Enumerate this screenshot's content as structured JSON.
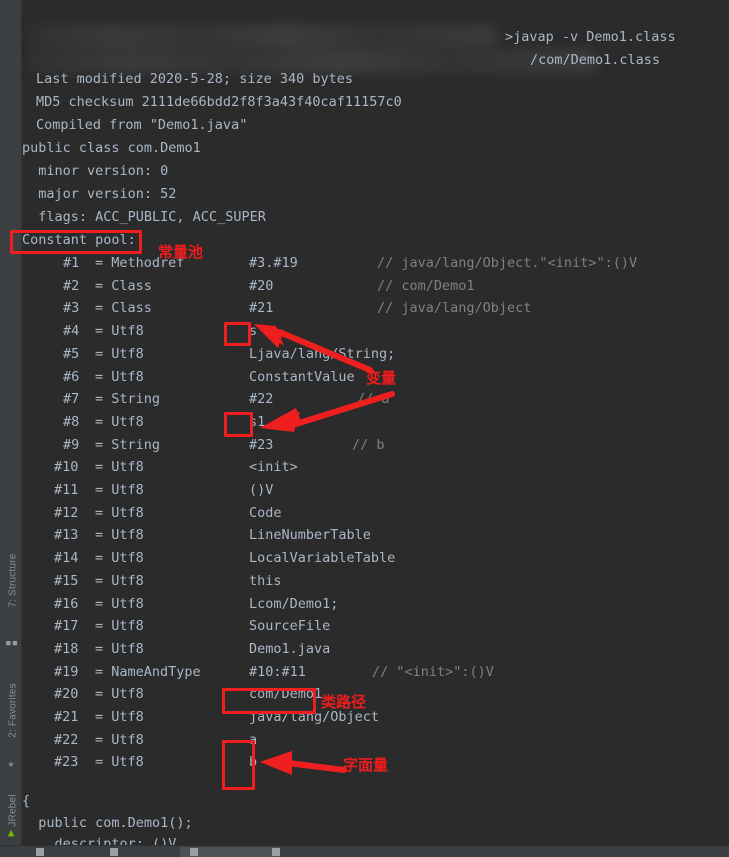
{
  "window": {
    "background": "#2b2b2b",
    "text_color": "#a9b7c6",
    "comment_color": "#808080",
    "annotation_color": "#ee1c1c"
  },
  "sidebar": {
    "items": [
      {
        "label": "7: Structure",
        "icon": "structure-icon"
      },
      {
        "label": "2: Favorites",
        "icon": "star-icon"
      },
      {
        "label": "JRebel",
        "icon": "jrebel-icon"
      }
    ]
  },
  "terminal": {
    "prompt_line": ">javap -v Demo1.class",
    "classfile_line": "/com/Demo1.class",
    "header": [
      "Last modified 2020-5-28; size 340 bytes",
      "MD5 checksum 2111de66bdd2f8f3a43f40caf11157c0",
      "Compiled from \"Demo1.java\"",
      "public class com.Demo1",
      "  minor version: 0",
      "  major version: 52",
      "  flags: ACC_PUBLIC, ACC_SUPER",
      "Constant pool:"
    ],
    "constant_pool": [
      {
        "index": "#1",
        "tag": "= Methodref",
        "value": "#3.#19",
        "comment": "// java/lang/Object.\"<init>\":()V"
      },
      {
        "index": "#2",
        "tag": "= Class",
        "value": "#20",
        "comment": "// com/Demo1"
      },
      {
        "index": "#3",
        "tag": "= Class",
        "value": "#21",
        "comment": "// java/lang/Object"
      },
      {
        "index": "#4",
        "tag": "= Utf8",
        "value": "s",
        "comment": ""
      },
      {
        "index": "#5",
        "tag": "= Utf8",
        "value": "Ljava/lang/String;",
        "comment": ""
      },
      {
        "index": "#6",
        "tag": "= Utf8",
        "value": "ConstantValue",
        "comment": ""
      },
      {
        "index": "#7",
        "tag": "= String",
        "value": "#22",
        "comment": "// a"
      },
      {
        "index": "#8",
        "tag": "= Utf8",
        "value": "s1",
        "comment": ""
      },
      {
        "index": "#9",
        "tag": "= String",
        "value": "#23",
        "comment": "// b"
      },
      {
        "index": "#10",
        "tag": "= Utf8",
        "value": "<init>",
        "comment": ""
      },
      {
        "index": "#11",
        "tag": "= Utf8",
        "value": "()V",
        "comment": ""
      },
      {
        "index": "#12",
        "tag": "= Utf8",
        "value": "Code",
        "comment": ""
      },
      {
        "index": "#13",
        "tag": "= Utf8",
        "value": "LineNumberTable",
        "comment": ""
      },
      {
        "index": "#14",
        "tag": "= Utf8",
        "value": "LocalVariableTable",
        "comment": ""
      },
      {
        "index": "#15",
        "tag": "= Utf8",
        "value": "this",
        "comment": ""
      },
      {
        "index": "#16",
        "tag": "= Utf8",
        "value": "Lcom/Demo1;",
        "comment": ""
      },
      {
        "index": "#17",
        "tag": "= Utf8",
        "value": "SourceFile",
        "comment": ""
      },
      {
        "index": "#18",
        "tag": "= Utf8",
        "value": "Demo1.java",
        "comment": ""
      },
      {
        "index": "#19",
        "tag": "= NameAndType",
        "value": "#10:#11",
        "comment": "// \"<init>\":()V"
      },
      {
        "index": "#20",
        "tag": "= Utf8",
        "value": "com/Demo1",
        "comment": ""
      },
      {
        "index": "#21",
        "tag": "= Utf8",
        "value": "java/lang/Object",
        "comment": ""
      },
      {
        "index": "#22",
        "tag": "= Utf8",
        "value": "a",
        "comment": ""
      },
      {
        "index": "#23",
        "tag": "= Utf8",
        "value": "b",
        "comment": ""
      }
    ],
    "footer": [
      "{",
      "  public com.Demo1();",
      "    descriptor: ()V"
    ]
  },
  "annotations": [
    {
      "id": "constant-pool",
      "label": "常量池"
    },
    {
      "id": "variable",
      "label": "变量"
    },
    {
      "id": "class-path",
      "label": "类路径"
    },
    {
      "id": "literal",
      "label": "字面量"
    }
  ]
}
